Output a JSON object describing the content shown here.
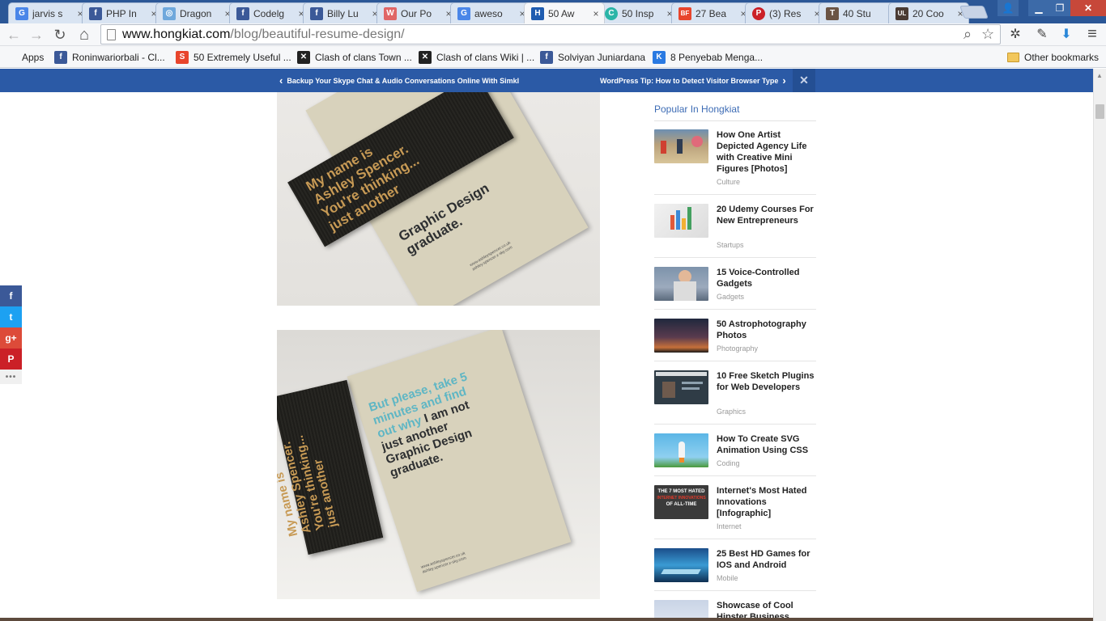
{
  "browser": {
    "tabs": [
      {
        "title": "jarvis s",
        "favicon": "G",
        "color": "#4a86e8"
      },
      {
        "title": "PHP In",
        "favicon": "f",
        "color": "#3b5998"
      },
      {
        "title": "Dragon",
        "favicon": "◎",
        "color": "#6fa8dc"
      },
      {
        "title": "Codelg",
        "favicon": "f",
        "color": "#3b5998"
      },
      {
        "title": "Billy Lu",
        "favicon": "f",
        "color": "#3b5998"
      },
      {
        "title": "Our Po",
        "favicon": "W",
        "color": "#e06666"
      },
      {
        "title": "aweso",
        "favicon": "G",
        "color": "#4a86e8"
      },
      {
        "title": "50 Aw",
        "favicon": "H",
        "color": "#1f5cb0"
      },
      {
        "title": "50 Insp",
        "favicon": "C",
        "color": "#2bb5a8"
      },
      {
        "title": "27 Bea",
        "favicon": "BF",
        "color": "#e8452c"
      },
      {
        "title": "(3) Res",
        "favicon": "P",
        "color": "#cb2027"
      },
      {
        "title": "40 Stu",
        "favicon": "T",
        "color": "#6b5444"
      },
      {
        "title": "20 Coo",
        "favicon": "UL",
        "color": "#4a3b33"
      }
    ],
    "active_tab_index": 7,
    "tab_close_glyph": "×",
    "window_controls": {
      "user": "👤",
      "minimize": "▁",
      "maximize": "❐",
      "close": "✕"
    }
  },
  "toolbar": {
    "back_glyph": "←",
    "forward_glyph": "→",
    "reload_glyph": "↻",
    "home_glyph": "⌂",
    "url_domain": "www.hongkiat.com",
    "url_path": "/blog/beautiful-resume-design/",
    "search_glyph": "⌕",
    "star_glyph": "☆",
    "ext_bug_glyph": "✲",
    "ext_picker_glyph": "✎",
    "ext_download_glyph": "⬇",
    "menu_glyph": "≡"
  },
  "bookmarks": {
    "apps_label": "Apps",
    "items": [
      {
        "label": "Roninwariorbali - Cl...",
        "favicon": "f",
        "color": "#3b5998"
      },
      {
        "label": "50 Extremely Useful ...",
        "favicon": "S",
        "color": "#e8452c"
      },
      {
        "label": "Clash of clans Town ...",
        "favicon": "✕",
        "color": "#222222"
      },
      {
        "label": "Clash of clans Wiki | ...",
        "favicon": "✕",
        "color": "#222222"
      },
      {
        "label": "Solviyan Juniardana",
        "favicon": "f",
        "color": "#3b5998"
      },
      {
        "label": "8 Penyebab Menga...",
        "favicon": "K",
        "color": "#2a7ae2"
      }
    ],
    "other_label": "Other bookmarks"
  },
  "article_nav": {
    "prev_label": "Backup Your Skype Chat & Audio Conversations Online With Simkl",
    "next_label": "WordPress Tip: How to Detect Visitor Browser Type",
    "prev_glyph": "‹",
    "next_glyph": "›",
    "close_glyph": "✕"
  },
  "images": {
    "img1": {
      "dark_card_lines": [
        "My name is",
        "Ashley Spencer.",
        "You're thinking...",
        "just another"
      ],
      "light_card_lines": [
        "Graphic Design",
        "graduate."
      ],
      "fine_print": [
        "www.ashleyspencer.co.uk",
        "ashley.spencer.x-sky.com"
      ]
    },
    "img2": {
      "dark_card_lines": [
        "My name is",
        "Ashley Spencer.",
        "You're thinking...",
        "just another"
      ],
      "light_card_teal_lines": [
        "But please, take 5",
        "minutes and find",
        "out why"
      ],
      "light_card_dark_inline": "I am not",
      "light_card_dark_lines": [
        "just another",
        "Graphic Design",
        "graduate."
      ],
      "fine_print": [
        "www.ashleyspencer.co.uk",
        "ashley.spencer.x-sky.com"
      ]
    }
  },
  "share": {
    "facebook": "f",
    "twitter": "t",
    "googleplus": "g+",
    "pinterest": "P",
    "more": "•••"
  },
  "sidebar": {
    "title": "Popular In Hongkiat",
    "items": [
      {
        "title": "How One Artist Depicted Agency Life with Creative Mini Figures [Photos]",
        "category": "Culture"
      },
      {
        "title": "20 Udemy Courses For New Entrepreneurs",
        "category": "Startups"
      },
      {
        "title": "15 Voice-Controlled Gadgets",
        "category": "Gadgets"
      },
      {
        "title": "50 Astrophotography Photos",
        "category": "Photography"
      },
      {
        "title": "10 Free Sketch Plugins for Web Developers",
        "category": "Graphics"
      },
      {
        "title": "How To Create SVG Animation Using CSS",
        "category": "Coding"
      },
      {
        "title": "Internet's Most Hated Innovations [Infographic]",
        "category": "Internet"
      },
      {
        "title": "25 Best HD Games for IOS and Android",
        "category": "Mobile"
      },
      {
        "title": "Showcase of Cool Hipster Business",
        "category": ""
      }
    ],
    "thumb7_text": [
      "THE 7 MOST HATED",
      "INTERNET INNOVATIONS",
      "OF ALL-TIME"
    ]
  }
}
